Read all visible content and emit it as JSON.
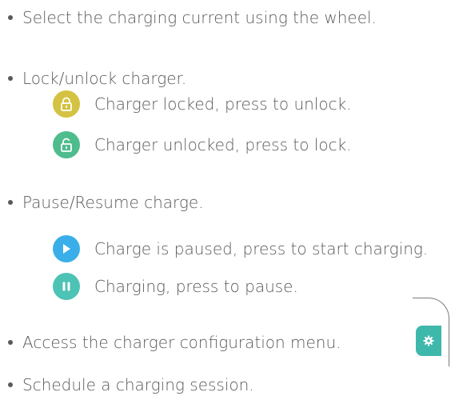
{
  "items": {
    "select_current": "Select the charging current using the wheel.",
    "lock_unlock": "Lock/unlock charger.",
    "locked": "Charger locked, press to unlock.",
    "unlocked": "Charger unlocked, press to lock.",
    "pause_resume": "Pause/Resume charge.",
    "paused": "Charge is paused, press to start charging.",
    "charging": "Charging, press to pause.",
    "config_menu": "Access the charger configuration menu.",
    "schedule": "Schedule a charging session."
  },
  "icons": {
    "locked": "lock-icon",
    "unlocked": "unlock-icon",
    "paused": "play-icon",
    "charging": "pause-icon",
    "config": "gear-icon"
  },
  "colors": {
    "text": "#5a5a5a",
    "locked": "#d4c242",
    "unlocked": "#4fbc8e",
    "play": "#3aaee8",
    "pause": "#4cc3b5",
    "config": "#3fb8ac"
  }
}
